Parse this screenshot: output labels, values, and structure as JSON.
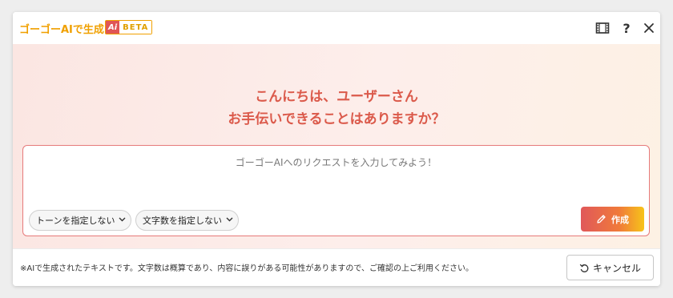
{
  "header": {
    "app_title": "ゴーゴーAIで生成",
    "badge_ai": "Ai",
    "badge_label": "BETA",
    "icons": [
      "film-icon",
      "help-icon",
      "close-icon"
    ],
    "help_label": "?"
  },
  "main": {
    "greeting_line1": "こんにちは、ユーザーさん",
    "greeting_line2": "お手伝いできることはありますか？",
    "input": {
      "value": "",
      "placeholder": "ゴーゴーAIへのリクエストを入力してみよう！"
    },
    "tone_select": "トーンを指定しない",
    "length_select": "文字数を指定しない",
    "create_button": "作成"
  },
  "footer": {
    "disclaimer": "※AIで生成されたテキストです。文字数は概算であり、内容に誤りがある可能性がありますので、ご確認の上ご利用ください。",
    "cancel_button": "キャンセル"
  },
  "colors": {
    "accent_title": "#f0a000",
    "greeting": "#db5a4b",
    "input_border": "#e67a7a",
    "button_gradient_start": "#e0585a",
    "button_gradient_end": "#f7c419"
  }
}
